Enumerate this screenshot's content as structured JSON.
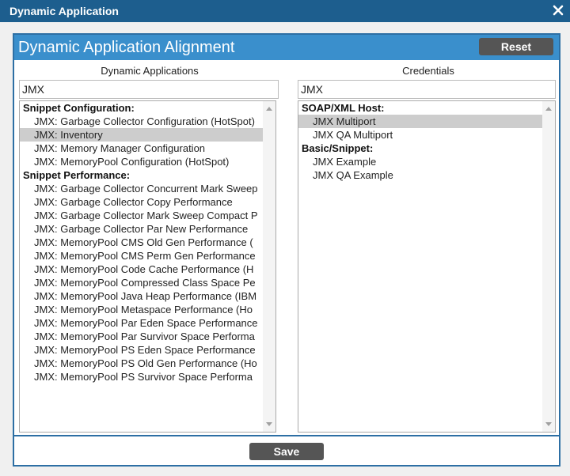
{
  "window": {
    "title": "Dynamic Application"
  },
  "dialog": {
    "title": "Dynamic Application Alignment",
    "reset_label": "Reset",
    "save_label": "Save"
  },
  "apps": {
    "label": "Dynamic Applications",
    "filter_value": "JMX",
    "groups": [
      {
        "name": "Snippet Configuration:",
        "items": [
          {
            "label": "JMX: Garbage Collector Configuration (HotSpot)",
            "selected": false
          },
          {
            "label": "JMX: Inventory",
            "selected": true
          },
          {
            "label": "JMX: Memory Manager Configuration",
            "selected": false
          },
          {
            "label": "JMX: MemoryPool Configuration (HotSpot)",
            "selected": false
          }
        ]
      },
      {
        "name": "Snippet Performance:",
        "items": [
          {
            "label": "JMX: Garbage Collector Concurrent Mark Sweep",
            "selected": false
          },
          {
            "label": "JMX: Garbage Collector Copy Performance",
            "selected": false
          },
          {
            "label": "JMX: Garbage Collector Mark Sweep Compact P",
            "selected": false
          },
          {
            "label": "JMX: Garbage Collector Par New Performance",
            "selected": false
          },
          {
            "label": "JMX: MemoryPool CMS Old Gen Performance (",
            "selected": false
          },
          {
            "label": "JMX: MemoryPool CMS Perm Gen Performance",
            "selected": false
          },
          {
            "label": "JMX: MemoryPool Code Cache Performance (H",
            "selected": false
          },
          {
            "label": "JMX: MemoryPool Compressed Class Space Pe",
            "selected": false
          },
          {
            "label": "JMX: MemoryPool Java Heap Performance (IBM",
            "selected": false
          },
          {
            "label": "JMX: MemoryPool Metaspace Performance (Ho",
            "selected": false
          },
          {
            "label": "JMX: MemoryPool Par Eden Space Performance",
            "selected": false
          },
          {
            "label": "JMX: MemoryPool Par Survivor Space Performa",
            "selected": false
          },
          {
            "label": "JMX: MemoryPool PS Eden Space Performance",
            "selected": false
          },
          {
            "label": "JMX: MemoryPool PS Old Gen Performance (Ho",
            "selected": false
          },
          {
            "label": "JMX: MemoryPool PS Survivor Space Performa",
            "selected": false
          }
        ]
      }
    ]
  },
  "credentials": {
    "label": "Credentials",
    "filter_value": "JMX",
    "groups": [
      {
        "name": "SOAP/XML Host:",
        "items": [
          {
            "label": "JMX Multiport",
            "selected": true
          },
          {
            "label": "JMX QA Multiport",
            "selected": false
          }
        ]
      },
      {
        "name": "Basic/Snippet:",
        "items": [
          {
            "label": "JMX Example",
            "selected": false
          },
          {
            "label": "JMX QA Example",
            "selected": false
          }
        ]
      }
    ]
  },
  "colors": {
    "titlebar": "#1d5e8e",
    "header": "#3a8fcc",
    "button": "#555555",
    "selected": "#cdcdcd"
  }
}
